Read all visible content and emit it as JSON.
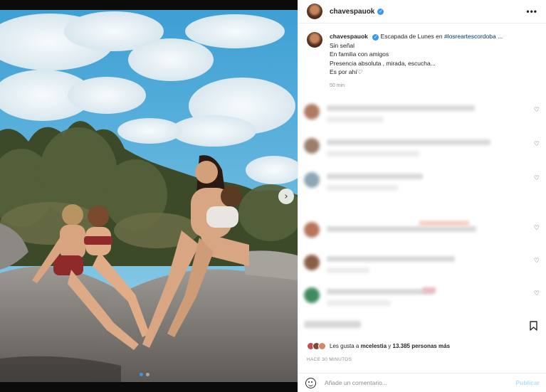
{
  "post": {
    "username": "chavespauok",
    "verified_icon": "verified-badge-icon",
    "more_label": "•••"
  },
  "caption": {
    "username": "chavespauok",
    "intro": "Escapada de Lunes en ",
    "hashtag": "#losreartescordoba ...",
    "lines": [
      "Sin señal",
      "En familia con amigos",
      "Presencia absoluta , mirada, escucha...",
      "Es por ahí"
    ],
    "heart_glyph": "♡",
    "time": "50 min"
  },
  "photo": {
    "next_glyph": "›",
    "slide_count": 2,
    "active_slide": 1
  },
  "comments": {
    "heart_glyph": "♡",
    "count_visible": 6,
    "blurred": true
  },
  "likes": {
    "prefix": "Les gusta a ",
    "user": "mcelestia",
    "middle": " y ",
    "count": "13.385",
    "suffix": " personas más"
  },
  "time_ago": "HACE 30 MINUTOS",
  "add_comment": {
    "placeholder": "Añade un comentario...",
    "publish_label": "Publicar"
  },
  "colors": {
    "accent": "#3897f0",
    "hashtag": "#00376b",
    "publish_disabled": "#b2dffc",
    "muted": "#8e8e8e"
  }
}
